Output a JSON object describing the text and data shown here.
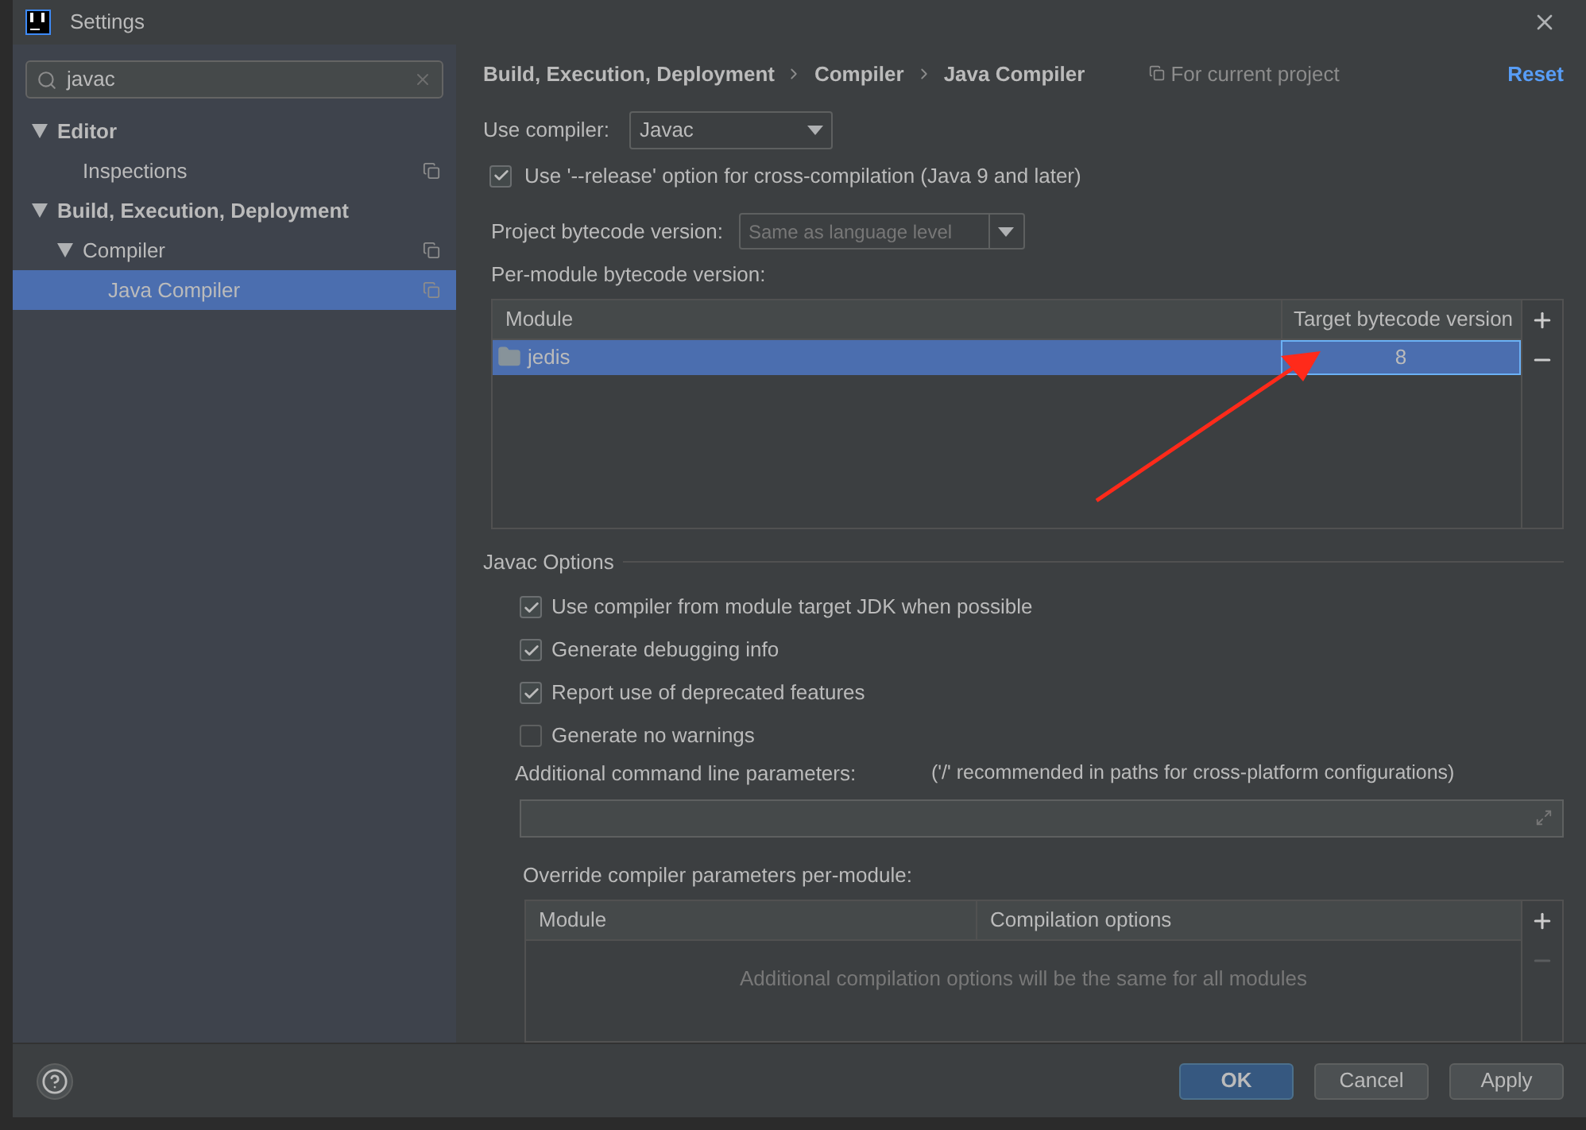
{
  "window": {
    "title": "Settings"
  },
  "sidebar": {
    "search": {
      "value": "javac"
    },
    "tree": [
      {
        "label": "Editor",
        "expanded": true,
        "selected": false,
        "children": [
          {
            "label": "Inspections",
            "selected": false,
            "project_scope": true
          }
        ]
      },
      {
        "label": "Build, Execution, Deployment",
        "expanded": true,
        "selected": false,
        "children": [
          {
            "label": "Compiler",
            "expanded": true,
            "selected": false,
            "project_scope": true,
            "children": [
              {
                "label": "Java Compiler",
                "selected": true,
                "project_scope": true
              }
            ]
          }
        ]
      }
    ]
  },
  "breadcrumb": [
    "Build, Execution, Deployment",
    "Compiler",
    "Java Compiler"
  ],
  "scope_note": "For current project",
  "reset": "Reset",
  "use_compiler": {
    "label": "Use compiler:",
    "value": "Javac"
  },
  "release_option": {
    "label": "Use '--release' option for cross-compilation (Java 9 and later)",
    "checked": true
  },
  "bytecode_version": {
    "label": "Project bytecode version:",
    "placeholder": "Same as language level",
    "disabled": true
  },
  "per_module": {
    "label": "Per-module bytecode version:",
    "columns": [
      "Module",
      "Target bytecode version"
    ],
    "rows": [
      {
        "module": "jedis",
        "version": "8",
        "selected": true
      }
    ]
  },
  "javac_options": {
    "title": "Javac Options",
    "options": [
      {
        "label": "Use compiler from module target JDK when possible",
        "checked": true
      },
      {
        "label": "Generate debugging info",
        "checked": true
      },
      {
        "label": "Report use of deprecated features",
        "checked": true
      },
      {
        "label": "Generate no warnings",
        "checked": false
      }
    ],
    "params_label": "Additional command line parameters:",
    "params_hint": "('/' recommended in paths for cross-platform configurations)"
  },
  "override": {
    "label": "Override compiler parameters per-module:",
    "columns": [
      "Module",
      "Compilation options"
    ],
    "empty_text": "Additional compilation options will be the same for all modules"
  },
  "buttons": [
    {
      "label": "OK",
      "kind": "primary"
    },
    {
      "label": "Cancel",
      "kind": "default"
    },
    {
      "label": "Apply",
      "kind": "default"
    }
  ]
}
